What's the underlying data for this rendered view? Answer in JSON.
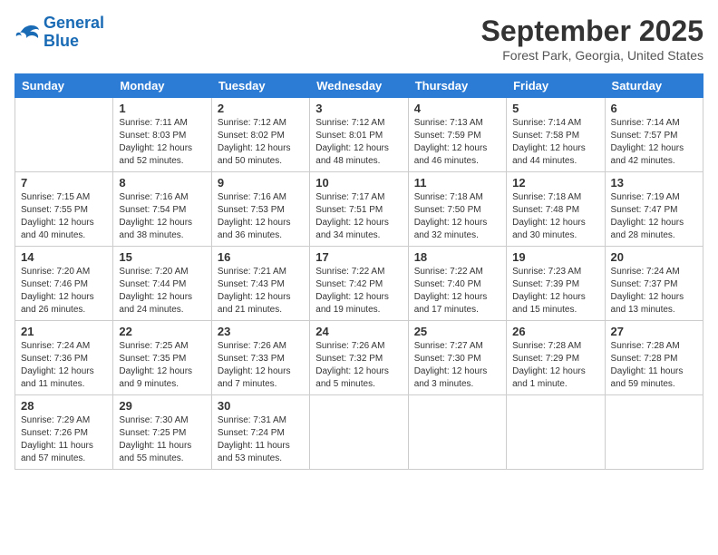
{
  "header": {
    "logo_line1": "General",
    "logo_line2": "Blue",
    "month": "September 2025",
    "location": "Forest Park, Georgia, United States"
  },
  "days_of_week": [
    "Sunday",
    "Monday",
    "Tuesday",
    "Wednesday",
    "Thursday",
    "Friday",
    "Saturday"
  ],
  "weeks": [
    [
      {
        "day": "",
        "info": ""
      },
      {
        "day": "1",
        "info": "Sunrise: 7:11 AM\nSunset: 8:03 PM\nDaylight: 12 hours\nand 52 minutes."
      },
      {
        "day": "2",
        "info": "Sunrise: 7:12 AM\nSunset: 8:02 PM\nDaylight: 12 hours\nand 50 minutes."
      },
      {
        "day": "3",
        "info": "Sunrise: 7:12 AM\nSunset: 8:01 PM\nDaylight: 12 hours\nand 48 minutes."
      },
      {
        "day": "4",
        "info": "Sunrise: 7:13 AM\nSunset: 7:59 PM\nDaylight: 12 hours\nand 46 minutes."
      },
      {
        "day": "5",
        "info": "Sunrise: 7:14 AM\nSunset: 7:58 PM\nDaylight: 12 hours\nand 44 minutes."
      },
      {
        "day": "6",
        "info": "Sunrise: 7:14 AM\nSunset: 7:57 PM\nDaylight: 12 hours\nand 42 minutes."
      }
    ],
    [
      {
        "day": "7",
        "info": "Sunrise: 7:15 AM\nSunset: 7:55 PM\nDaylight: 12 hours\nand 40 minutes."
      },
      {
        "day": "8",
        "info": "Sunrise: 7:16 AM\nSunset: 7:54 PM\nDaylight: 12 hours\nand 38 minutes."
      },
      {
        "day": "9",
        "info": "Sunrise: 7:16 AM\nSunset: 7:53 PM\nDaylight: 12 hours\nand 36 minutes."
      },
      {
        "day": "10",
        "info": "Sunrise: 7:17 AM\nSunset: 7:51 PM\nDaylight: 12 hours\nand 34 minutes."
      },
      {
        "day": "11",
        "info": "Sunrise: 7:18 AM\nSunset: 7:50 PM\nDaylight: 12 hours\nand 32 minutes."
      },
      {
        "day": "12",
        "info": "Sunrise: 7:18 AM\nSunset: 7:48 PM\nDaylight: 12 hours\nand 30 minutes."
      },
      {
        "day": "13",
        "info": "Sunrise: 7:19 AM\nSunset: 7:47 PM\nDaylight: 12 hours\nand 28 minutes."
      }
    ],
    [
      {
        "day": "14",
        "info": "Sunrise: 7:20 AM\nSunset: 7:46 PM\nDaylight: 12 hours\nand 26 minutes."
      },
      {
        "day": "15",
        "info": "Sunrise: 7:20 AM\nSunset: 7:44 PM\nDaylight: 12 hours\nand 24 minutes."
      },
      {
        "day": "16",
        "info": "Sunrise: 7:21 AM\nSunset: 7:43 PM\nDaylight: 12 hours\nand 21 minutes."
      },
      {
        "day": "17",
        "info": "Sunrise: 7:22 AM\nSunset: 7:42 PM\nDaylight: 12 hours\nand 19 minutes."
      },
      {
        "day": "18",
        "info": "Sunrise: 7:22 AM\nSunset: 7:40 PM\nDaylight: 12 hours\nand 17 minutes."
      },
      {
        "day": "19",
        "info": "Sunrise: 7:23 AM\nSunset: 7:39 PM\nDaylight: 12 hours\nand 15 minutes."
      },
      {
        "day": "20",
        "info": "Sunrise: 7:24 AM\nSunset: 7:37 PM\nDaylight: 12 hours\nand 13 minutes."
      }
    ],
    [
      {
        "day": "21",
        "info": "Sunrise: 7:24 AM\nSunset: 7:36 PM\nDaylight: 12 hours\nand 11 minutes."
      },
      {
        "day": "22",
        "info": "Sunrise: 7:25 AM\nSunset: 7:35 PM\nDaylight: 12 hours\nand 9 minutes."
      },
      {
        "day": "23",
        "info": "Sunrise: 7:26 AM\nSunset: 7:33 PM\nDaylight: 12 hours\nand 7 minutes."
      },
      {
        "day": "24",
        "info": "Sunrise: 7:26 AM\nSunset: 7:32 PM\nDaylight: 12 hours\nand 5 minutes."
      },
      {
        "day": "25",
        "info": "Sunrise: 7:27 AM\nSunset: 7:30 PM\nDaylight: 12 hours\nand 3 minutes."
      },
      {
        "day": "26",
        "info": "Sunrise: 7:28 AM\nSunset: 7:29 PM\nDaylight: 12 hours\nand 1 minute."
      },
      {
        "day": "27",
        "info": "Sunrise: 7:28 AM\nSunset: 7:28 PM\nDaylight: 11 hours\nand 59 minutes."
      }
    ],
    [
      {
        "day": "28",
        "info": "Sunrise: 7:29 AM\nSunset: 7:26 PM\nDaylight: 11 hours\nand 57 minutes."
      },
      {
        "day": "29",
        "info": "Sunrise: 7:30 AM\nSunset: 7:25 PM\nDaylight: 11 hours\nand 55 minutes."
      },
      {
        "day": "30",
        "info": "Sunrise: 7:31 AM\nSunset: 7:24 PM\nDaylight: 11 hours\nand 53 minutes."
      },
      {
        "day": "",
        "info": ""
      },
      {
        "day": "",
        "info": ""
      },
      {
        "day": "",
        "info": ""
      },
      {
        "day": "",
        "info": ""
      }
    ]
  ]
}
